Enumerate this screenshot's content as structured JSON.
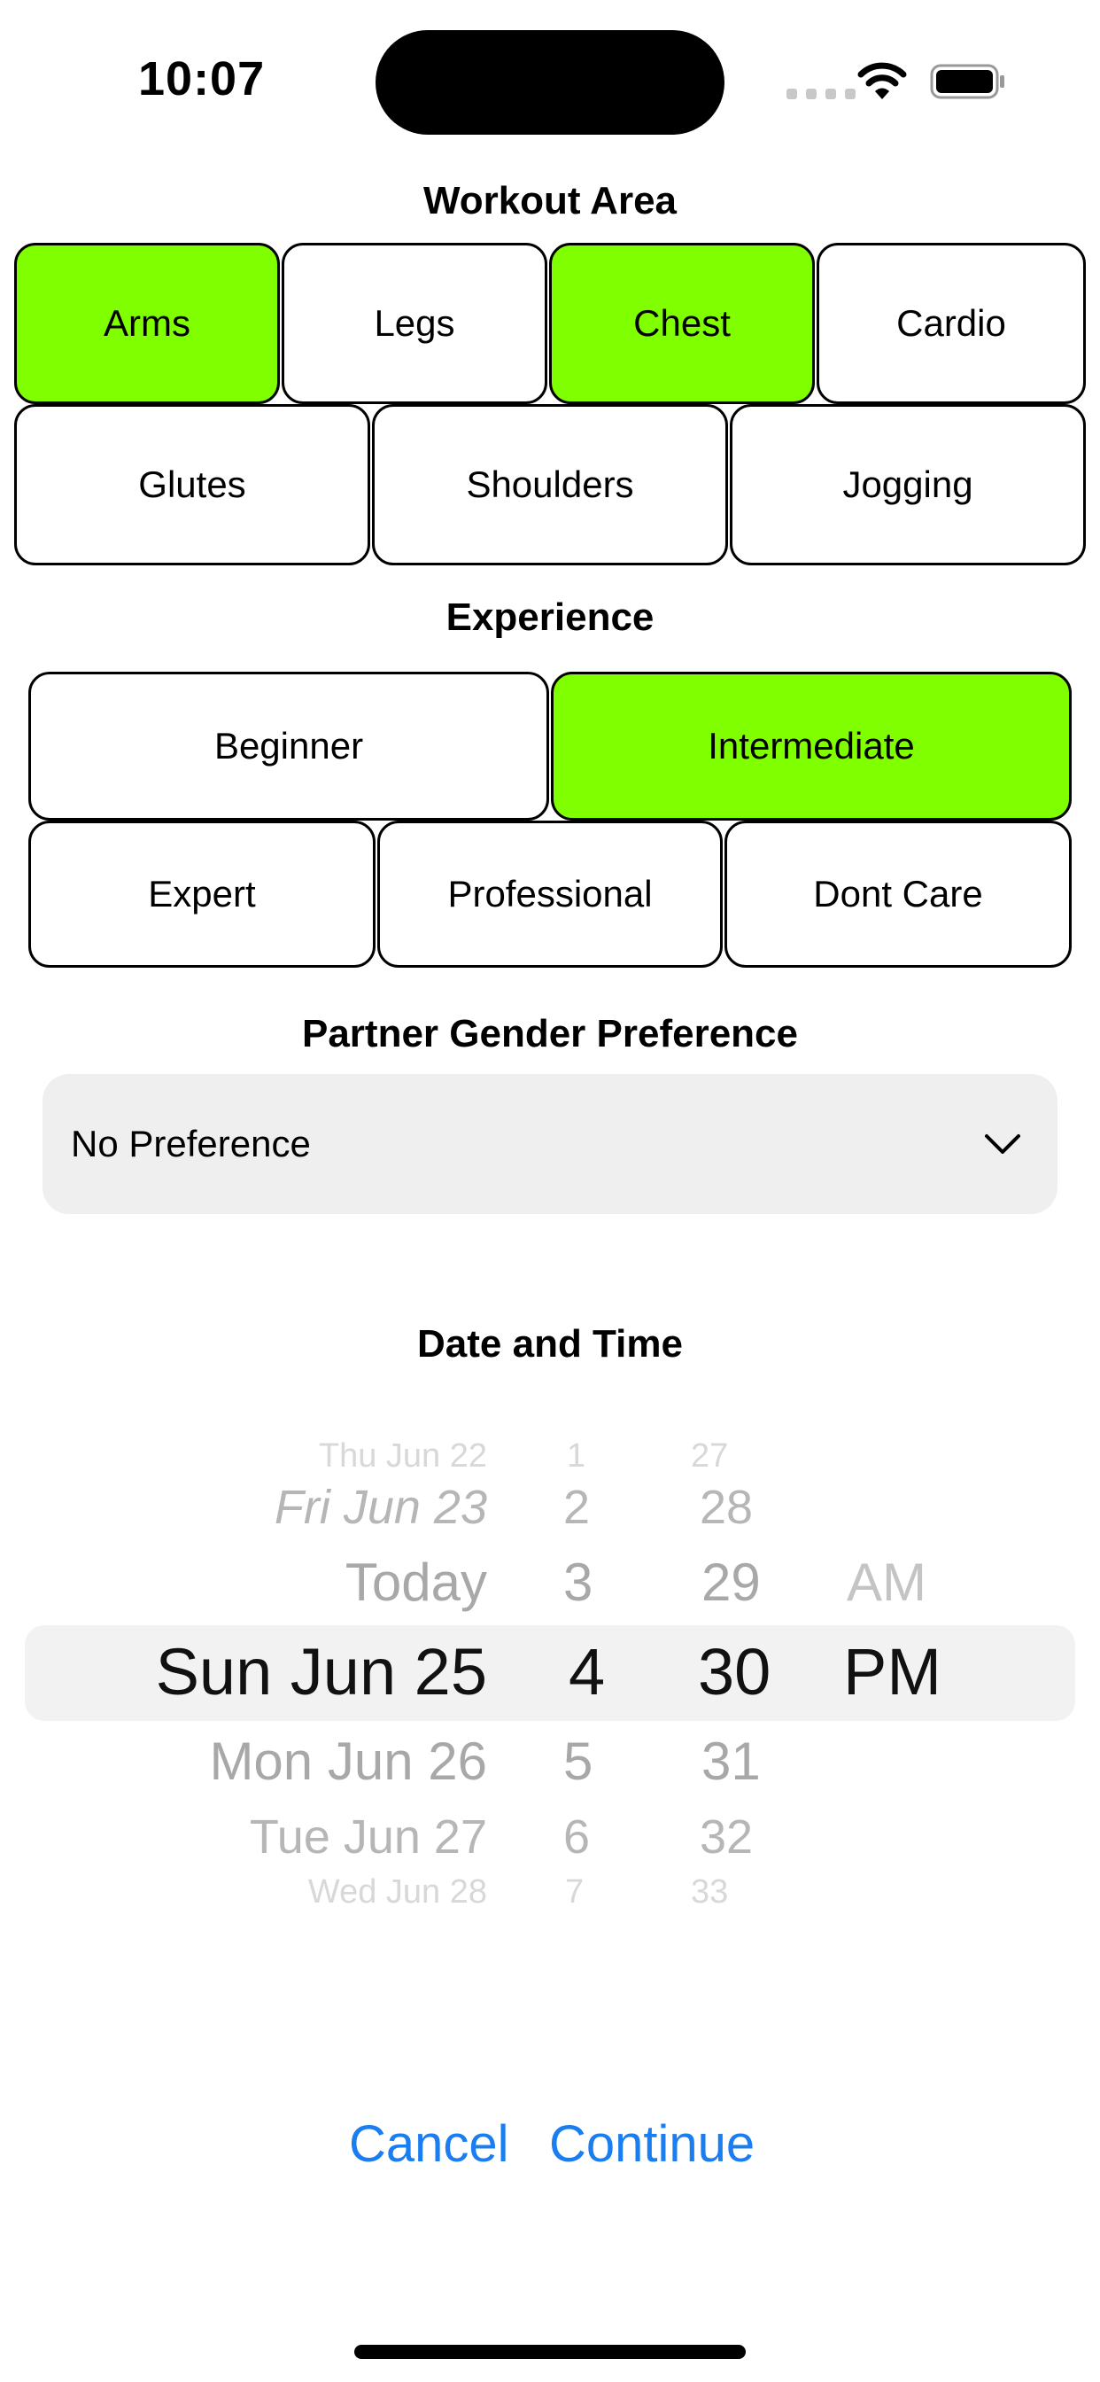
{
  "status_bar": {
    "time": "10:07"
  },
  "workout_area": {
    "title": "Workout Area",
    "options": [
      {
        "label": "Arms",
        "selected": true
      },
      {
        "label": "Legs",
        "selected": false
      },
      {
        "label": "Chest",
        "selected": true
      },
      {
        "label": "Cardio",
        "selected": false
      },
      {
        "label": "Glutes",
        "selected": false
      },
      {
        "label": "Shoulders",
        "selected": false
      },
      {
        "label": "Jogging",
        "selected": false
      }
    ]
  },
  "experience": {
    "title": "Experience",
    "options": [
      {
        "label": "Beginner",
        "selected": false
      },
      {
        "label": "Intermediate",
        "selected": true
      },
      {
        "label": "Expert",
        "selected": false
      },
      {
        "label": "Professional",
        "selected": false
      },
      {
        "label": "Dont Care",
        "selected": false
      }
    ]
  },
  "partner_gender": {
    "title": "Partner Gender Preference",
    "value": "No Preference"
  },
  "date_time": {
    "title": "Date and Time",
    "dates": [
      "Thu Jun 22",
      "Fri Jun 23",
      "Today",
      "Sun Jun 25",
      "Mon Jun 26",
      "Tue Jun 27",
      "Wed Jun 28"
    ],
    "hours": [
      "1",
      "2",
      "3",
      "4",
      "5",
      "6",
      "7"
    ],
    "minutes": [
      "27",
      "28",
      "29",
      "30",
      "31",
      "32",
      "33"
    ],
    "periods": [
      "AM",
      "PM"
    ],
    "selected": {
      "date": "Sun Jun 25",
      "hour": "4",
      "minute": "30",
      "period": "PM"
    }
  },
  "actions": {
    "cancel": "Cancel",
    "continue": "Continue"
  },
  "colors": {
    "selected_tile": "#80ff00",
    "action_blue": "#1a7ef0"
  }
}
